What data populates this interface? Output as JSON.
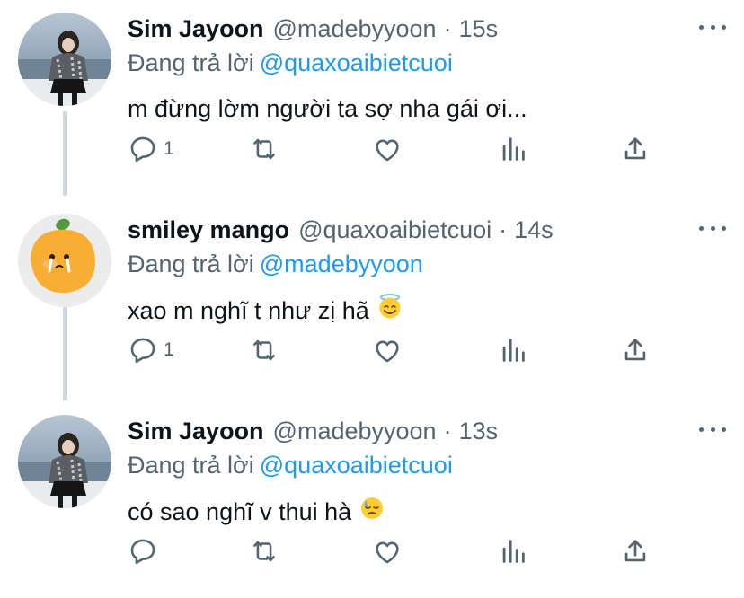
{
  "tweets": [
    {
      "name": "Sim Jayoon",
      "handle": "@madebyyoon",
      "time": "15s",
      "reply_prefix": "Đang trả lời",
      "reply_to": "@quaxoaibietcuoi",
      "text": "m đừng lờm người ta sợ nha gái ơi...",
      "emoji": "",
      "reply_count": "1",
      "avatar": "photo-girl-seaside"
    },
    {
      "name": "smiley mango",
      "handle": "@quaxoaibietcuoi",
      "time": "14s",
      "reply_prefix": "Đang trả lời",
      "reply_to": "@madebyyoon",
      "text": "xao m nghĩ t như zị hã",
      "emoji": "halo-smile-emoji",
      "reply_count": "1",
      "avatar": "mango-crying"
    },
    {
      "name": "Sim Jayoon",
      "handle": "@madebyyoon",
      "time": "13s",
      "reply_prefix": "Đang trả lời",
      "reply_to": "@quaxoaibietcuoi",
      "text": "có sao nghĩ v thui hà",
      "emoji": "downcast-sweat-emoji",
      "reply_count": "",
      "avatar": "photo-girl-seaside"
    }
  ],
  "icons": [
    "reply-icon",
    "retweet-icon",
    "like-icon",
    "analytics-icon",
    "share-icon",
    "more-icon"
  ],
  "colors": {
    "text": "#0f1419",
    "secondary": "#536471",
    "accent": "#1d9bf0",
    "thread_line": "#cfd9de"
  }
}
